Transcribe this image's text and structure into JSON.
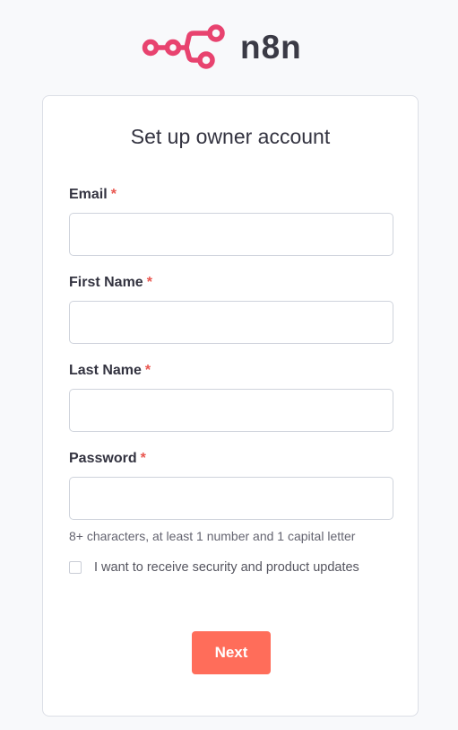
{
  "brand": {
    "logo_icon": "n8n-logo-icon",
    "name": "n8n",
    "color": "#e8436f"
  },
  "form": {
    "title": "Set up owner account",
    "fields": [
      {
        "label": "Email",
        "required_mark": "*",
        "value": "",
        "placeholder": ""
      },
      {
        "label": "First Name",
        "required_mark": "*",
        "value": "",
        "placeholder": ""
      },
      {
        "label": "Last Name",
        "required_mark": "*",
        "value": "",
        "placeholder": ""
      },
      {
        "label": "Password",
        "required_mark": "*",
        "value": "",
        "placeholder": ""
      }
    ],
    "password_hint": "8+ characters, at least 1 number and 1 capital letter",
    "updates_checkbox": {
      "label": "I want to receive security and product updates",
      "checked": false
    },
    "submit_label": "Next"
  },
  "colors": {
    "accent": "#ff6d5a",
    "required": "#e9564f",
    "background": "#f8f9fb"
  }
}
